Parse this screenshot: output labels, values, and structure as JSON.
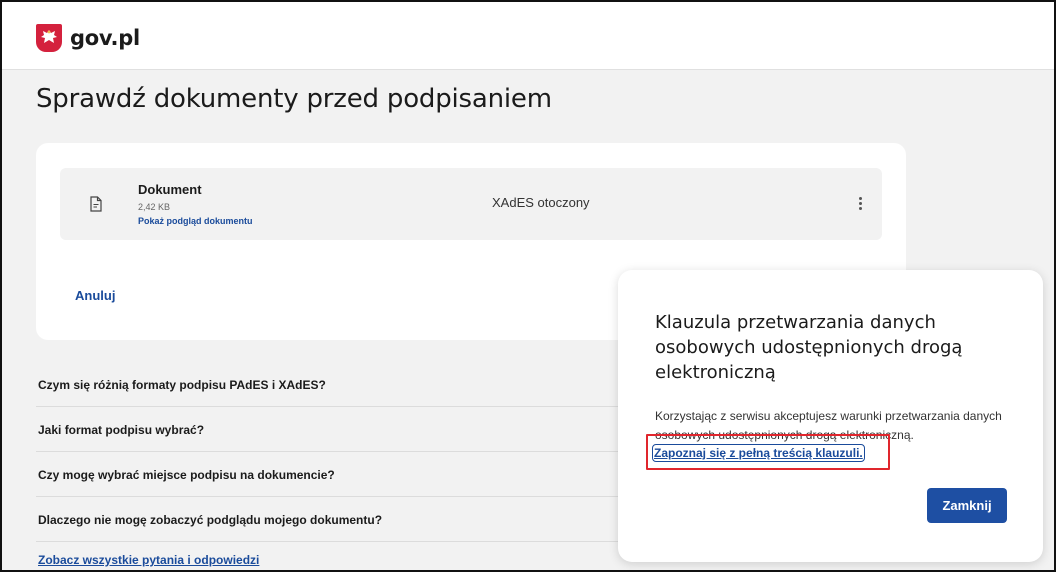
{
  "header": {
    "logo_text": "gov.pl",
    "emblem_icon": "polish-eagle-emblem",
    "emblem_color": "#d4213d"
  },
  "page": {
    "title": "Sprawdź dokumenty przed podpisaniem"
  },
  "document": {
    "icon": "document-icon",
    "name": "Dokument",
    "size": "2,42 KB",
    "preview_link": "Pokaż podgląd dokumentu",
    "format": "XAdES otoczony",
    "menu_icon": "kebab-menu-icon"
  },
  "actions": {
    "cancel_label": "Anuluj"
  },
  "faq": {
    "items": [
      "Czym się różnią formaty podpisu PAdES i XAdES?",
      "Jaki format podpisu wybrać?",
      "Czy mogę wybrać miejsce podpisu na dokumencie?",
      "Dlaczego nie mogę zobaczyć podglądu mojego dokumentu?"
    ],
    "all_link": "Zobacz wszystkie pytania i odpowiedzi"
  },
  "modal": {
    "title": "Klauzula przetwarzania danych osobowych udostępnionych drogą elektroniczną",
    "text": "Korzystając z serwisu akceptujesz warunki przetwarzania danych osobowych udostępnionych drogą elektroniczną.",
    "link": "Zapoznaj się z pełną treścią klauzuli.",
    "close_label": "Zamknij",
    "highlight_color": "#e0262d"
  },
  "colors": {
    "accent": "#1a4b9b",
    "button": "#1e4fa3",
    "background": "#f2f2f2"
  }
}
